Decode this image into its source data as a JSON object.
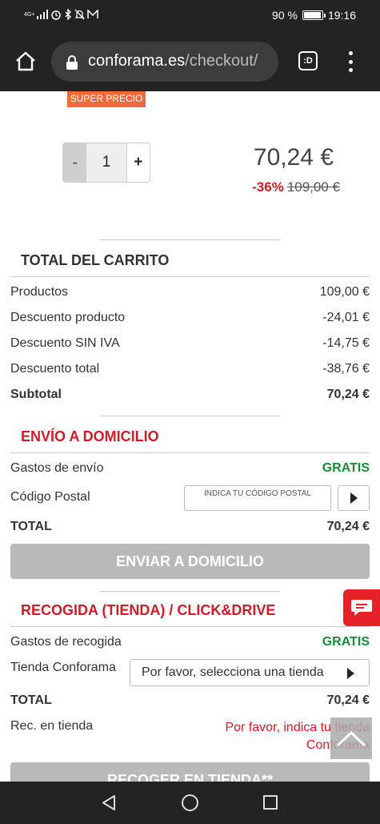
{
  "status_bar": {
    "network": "4G+",
    "battery": "90 %",
    "battery_level": 0.9,
    "time": "19:16"
  },
  "browser": {
    "url_domain": "conforama.es",
    "url_path": "/checkout/",
    "tab_label": ":D",
    "icons": [
      "home-icon",
      "lock-icon",
      "tab-switcher-icon",
      "overflow-menu-icon"
    ]
  },
  "product": {
    "badge": "SUPER PRECIO",
    "qty_minus": "-",
    "quantity": "1",
    "qty_plus": "+",
    "price": "70,24 €",
    "discount_pct": "-36%",
    "old_price": "109,00 €"
  },
  "cart_total": {
    "title": "TOTAL DEL CARRITO",
    "rows": [
      {
        "label": "Productos",
        "value": "109,00 €"
      },
      {
        "label": "Descuento producto",
        "value": "-24,01 €"
      },
      {
        "label": "Descuento SIN IVA",
        "value": "-14,75 €"
      },
      {
        "label": "Descuento total",
        "value": "-38,76 €"
      },
      {
        "label": "Subtotal",
        "value": "70,24 €"
      }
    ]
  },
  "home_delivery": {
    "title": "ENVÍO A DOMICILIO",
    "shipping_label": "Gastos de envío",
    "shipping_value": "GRATIS",
    "postal_label": "Código Postal",
    "postal_placeholder": "INDICA TU CÓDIGO POSTAL",
    "total_label": "TOTAL",
    "total_value": "70,24 €",
    "button": "ENVIAR A DOMICILIO"
  },
  "store_pickup": {
    "title": "RECOGIDA (TIENDA) / CLICK&DRIVE",
    "pickup_label": "Gastos de recogida",
    "pickup_value": "GRATIS",
    "store_label": "Tienda Conforama",
    "store_select": "Por favor, selecciona una tienda",
    "total_label": "TOTAL",
    "total_value": "70,24 €",
    "rec_label": "Rec. en tienda",
    "rec_message": "Por favor, indica tu tienda Conforama",
    "button": "RECOGER EN TIENDA**"
  },
  "colors": {
    "accent_red": "#d11a2a",
    "free_green": "#1a8a3a",
    "badge_orange": "#f26a3c",
    "button_grey": "#b9b9b9"
  }
}
